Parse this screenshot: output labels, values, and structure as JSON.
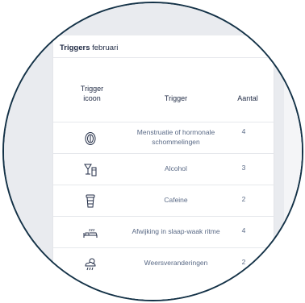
{
  "card": {
    "title_bold": "Triggers",
    "title_rest": " februari"
  },
  "table": {
    "headers": {
      "icon": "Trigger icoon",
      "trigger": "Trigger",
      "count": "Aantal"
    },
    "rows": [
      {
        "icon": "hormone-icon",
        "trigger": "Menstruatie of hormonale schommelingen",
        "count": "4"
      },
      {
        "icon": "alcohol-icon",
        "trigger": "Alcohol",
        "count": "3"
      },
      {
        "icon": "coffee-cup-icon",
        "trigger": "Cafeine",
        "count": "2"
      },
      {
        "icon": "sleep-bed-icon",
        "trigger": "Afwijking in slaap-waak ritme",
        "count": "4"
      },
      {
        "icon": "weather-cloud-icon",
        "trigger": "Weersveranderingen",
        "count": "2"
      }
    ]
  },
  "colors": {
    "frame": "#143247",
    "text_dark": "#1f2a44",
    "text_muted": "#5a6a86",
    "background": "#e9ebef"
  }
}
